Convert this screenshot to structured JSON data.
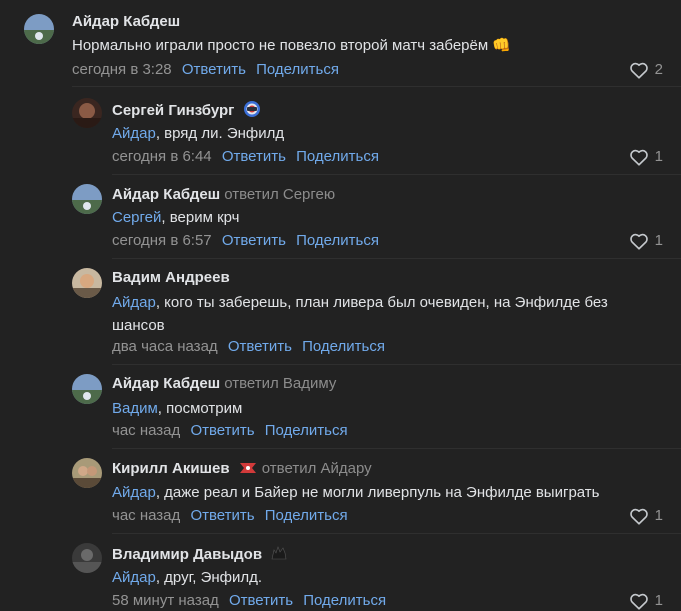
{
  "comments": [
    {
      "author": "Айдар Кабдеш",
      "reply_to": "",
      "mention": "",
      "text": "Нормально играли просто не повезло второй матч заберём 👊",
      "date": "сегодня в 3:28",
      "reply_label": "Ответить",
      "share_label": "Поделиться",
      "likes": "2",
      "avatar_color": "#6b8db5"
    },
    {
      "author": "Сергей Гинзбург",
      "reply_to": "",
      "mention": "Айдар",
      "text": ", вряд ли. Энфилд",
      "date": "сегодня в 6:44",
      "reply_label": "Ответить",
      "share_label": "Поделиться",
      "likes": "1",
      "avatar_color": "#5a3a30"
    },
    {
      "author": "Айдар Кабдеш",
      "reply_to": "ответил Сергею",
      "mention": "Сергей",
      "text": ", верим крч",
      "date": "сегодня в 6:57",
      "reply_label": "Ответить",
      "share_label": "Поделиться",
      "likes": "1",
      "avatar_color": "#6b8db5"
    },
    {
      "author": "Вадим Андреев",
      "reply_to": "",
      "mention": "Айдар",
      "text": ", кого ты заберешь, план ливера был очевиден, на Энфилде без",
      "text2": "шансов",
      "date": "два часа назад",
      "reply_label": "Ответить",
      "share_label": "Поделиться",
      "likes": "",
      "avatar_color": "#b08a6a"
    },
    {
      "author": "Айдар Кабдеш",
      "reply_to": "ответил Вадиму",
      "mention": "Вадим",
      "text": ", посмотрим",
      "date": "час назад",
      "reply_label": "Ответить",
      "share_label": "Поделиться",
      "likes": "",
      "avatar_color": "#6b8db5"
    },
    {
      "author": "Кирилл Акишев",
      "reply_to": "ответил Айдару",
      "mention": "Айдар",
      "text": ", даже реал и Байер не могли ливерпуль на Энфилде выиграть",
      "date": "час назад",
      "reply_label": "Ответить",
      "share_label": "Поделиться",
      "likes": "1",
      "avatar_color": "#8a7a5a"
    },
    {
      "author": "Владимир Давыдов",
      "reply_to": "",
      "mention": "Айдар",
      "text": ", друг, Энфилд.",
      "date": "58 минут назад",
      "reply_label": "Ответить",
      "share_label": "Поделиться",
      "likes": "1",
      "avatar_color": "#4a4a4a"
    }
  ],
  "colors": {
    "background": "#222222",
    "link": "#71aaeb",
    "secondary": "#939393",
    "text": "#e1e3e6"
  }
}
